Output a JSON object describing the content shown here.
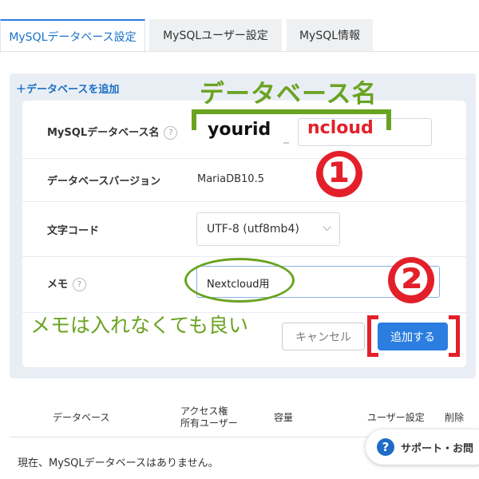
{
  "tabs": [
    {
      "label": "MySQLデータベース設定"
    },
    {
      "label": "MySQLユーザー設定"
    },
    {
      "label": "MySQL情報"
    }
  ],
  "add_database_link": "＋データベースを追加",
  "form": {
    "db_name_label": "MySQLデータベース名",
    "db_version_label": "データベースバージョン",
    "db_version_value": "MariaDB10.5",
    "charset_label": "文字コード",
    "charset_value": "UTF-8 (utf8mb4)",
    "memo_label": "メモ",
    "memo_value": "Nextcloud用",
    "help_mark": "?",
    "cancel_label": "キャンセル",
    "add_label": "追加する"
  },
  "annotations": {
    "db_name_title": "データベース名",
    "prefix": "yourid",
    "separator": "_",
    "suffix": "ncloud",
    "step1": "❶",
    "step2": "❷",
    "memo_note": "メモは入れなくても良い"
  },
  "table": {
    "headers": [
      "データベース",
      "アクセス権",
      "所有ユーザー",
      "容量",
      "ユーザー設定",
      "削除"
    ],
    "empty_message": "現在、MySQLデータベースはありません。"
  },
  "support": {
    "icon": "?",
    "label": "サポート・お問"
  },
  "colors": {
    "accent": "#2b7de0",
    "annotation_green": "#6aa321",
    "annotation_red": "#e3202a"
  }
}
